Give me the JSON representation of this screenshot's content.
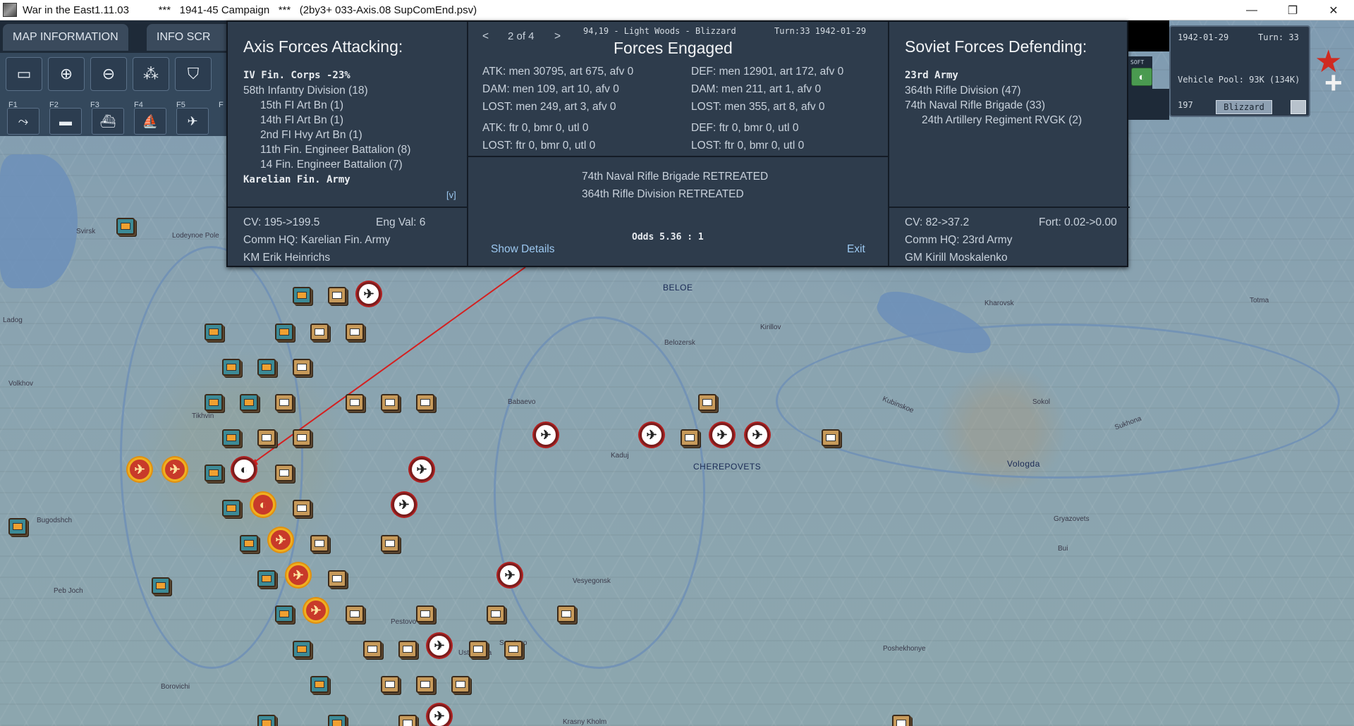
{
  "window": {
    "title": "War in the East1.11.03          ***   1941-45 Campaign   ***   (2by3+ 033-Axis.08 SupComEnd.psv)",
    "minimize": "—",
    "maximize": "❐",
    "close": "✕"
  },
  "tabs": {
    "map_information": "MAP INFORMATION",
    "info_screens": "INFO SCR"
  },
  "toolbar": {
    "fkeys": [
      "F1",
      "F2",
      "F3",
      "F4",
      "F5",
      "F"
    ]
  },
  "combat": {
    "axis": {
      "title": "Axis Forces Attacking:",
      "corps": "IV Fin. Corps  -23%",
      "units": [
        "58th Infantry Division (18)",
        "15th FI Art Bn (1)",
        "14th FI Art Bn (1)",
        "2nd FI Hvy Art Bn (1)",
        "11th Fin. Engineer Battalion (8)",
        "14 Fin. Engineer Battalion (7)"
      ],
      "army": "Karelian Fin. Army",
      "toggle": "[v]",
      "cv": "CV: 195->199.5",
      "eng_val": "Eng Val: 6",
      "comm_hq": "Comm HQ: Karelian Fin. Army",
      "leader": "KM Erik Heinrichs"
    },
    "engaged": {
      "prev": "<",
      "page": "2 of 4",
      "next": ">",
      "terrain": "94,19 - Light Woods - Blizzard",
      "turn": "Turn:33  1942-01-29",
      "title": "Forces Engaged",
      "atk": "ATK:  men 30795,  art 675,  afv 0",
      "def": "DEF:  men 12901,  art 172,  afv 0",
      "dam_a": "DAM:  men 109,  art 10,  afv 0",
      "dam_d": "DAM:  men 211,  art 1,  afv 0",
      "lost_a": "LOST:  men 249,  art 3,  afv 0",
      "lost_d": "LOST:  men 355,  art 8,  afv 0",
      "atk_air": "ATK:  ftr 0,  bmr 0,  utl 0",
      "def_air": "DEF:  ftr 0,  bmr 0,  utl 0",
      "lost_air_a": "LOST:  ftr 0,  bmr 0,  utl 0",
      "lost_air_d": "LOST:  ftr 0,  bmr 0,  utl 0",
      "results": [
        "74th Naval Rifle Brigade RETREATED",
        "364th Rifle Division RETREATED"
      ],
      "odds": "Odds 5.36 : 1",
      "show_details": "Show Details",
      "exit": "Exit"
    },
    "soviet": {
      "title": "Soviet Forces Defending:",
      "army": "23rd Army",
      "units": [
        "364th Rifle Division (47)",
        "74th Naval Rifle Brigade (33)",
        "24th Artillery Regiment RVGK (2)"
      ],
      "cv": "CV: 82->37.2",
      "fort": "Fort: 0.02->0.00",
      "comm_hq": "Comm HQ: 23rd Army",
      "leader": "GM Kirill Moskalenko"
    }
  },
  "hud": {
    "date": "1942-01-29",
    "turn": "Turn: 33",
    "vehicle_pool": "Vehicle Pool: 93K (134K)",
    "value": "197",
    "weather": "Blizzard",
    "soft_label": "SOFT"
  },
  "map": {
    "places": [
      "Svirsk",
      "Lodeynoe Pole",
      "Ladog",
      "Volkhov",
      "Tikhvin",
      "Babaevo",
      "Kaduj",
      "CHEREPOVETS",
      "Vologda",
      "BELOE",
      "Kirillov",
      "Belozersk",
      "Kharovsk",
      "Totma",
      "Kubinskoe",
      "Sokol",
      "Sukhona",
      "Bugodshch",
      "Peb Joch",
      "Vesyegonsk",
      "Pestovo",
      "Ustyuzhna",
      "Sandovo",
      "Borovichi",
      "Krasny Kholm",
      "Poshekhonye",
      "Gryazovets",
      "Bui"
    ]
  },
  "colors": {
    "panel_bg": "#2e3c4c",
    "map_water": "#6c8fba",
    "finnish_counter": "#3c8a96",
    "german_counter": "#c79a5a",
    "soviet_counter": "#c5a878"
  }
}
